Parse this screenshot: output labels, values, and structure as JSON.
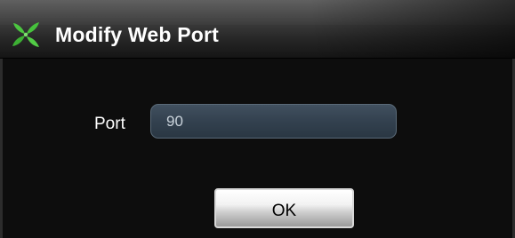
{
  "window": {
    "title": "Modify Web Port",
    "icon": "green-leaf-app-icon"
  },
  "form": {
    "port_label": "Port",
    "port_value": "90"
  },
  "buttons": {
    "ok_label": "OK"
  },
  "colors": {
    "titlebar": "#3a3a3a",
    "background": "#0d0d0d",
    "input_fill": "#33414f",
    "icon_green": "#3fbf3a"
  }
}
